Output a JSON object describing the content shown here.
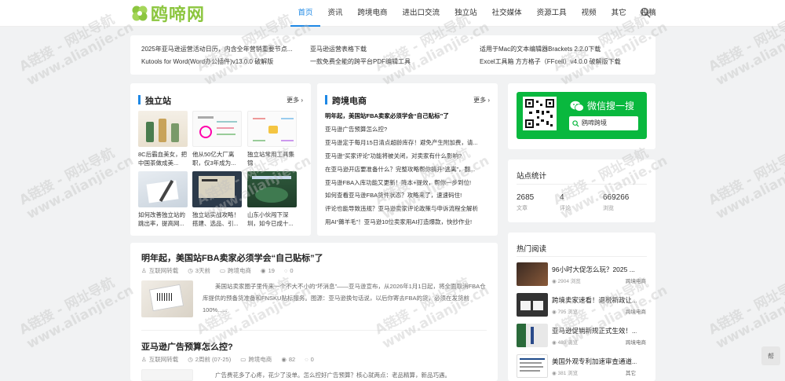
{
  "brand": {
    "logo_text": "鸥啼网"
  },
  "nav": {
    "items": [
      "首页",
      "资讯",
      "跨境电商",
      "进出口交流",
      "独立站",
      "社交媒体",
      "资源工具",
      "视频",
      "其它",
      "投稿"
    ],
    "active_index": 0
  },
  "ticker": [
    "2025年亚马逊运营活动日历，内含全年营销重要节点...",
    "Kutools for Word(Word办公插件)v13.0.0 破解版",
    "亚马逊运营表格下载",
    "一款免费全能的跨平台PDF编辑工具",
    "适用于Mac的文本编辑器Brackets 2.2.0下载",
    "Excel工具箱 方方格子（FFcell）v4.0.0 破解版下载"
  ],
  "independent": {
    "title": "独立站",
    "more": "更多",
    "items": [
      {
        "caption": "8C后霸血美女，把中国茶做成美..."
      },
      {
        "caption": "他从50亿大厂离职，仅3年成为..."
      },
      {
        "caption": "独立站常用工具集锦"
      },
      {
        "caption": "如何改善独立站的跳出率，提高网..."
      },
      {
        "caption": "独立站实战攻略！搭建、选品、引..."
      },
      {
        "caption": "山东小伙闯下深圳，如今已成十..."
      }
    ]
  },
  "cross_border": {
    "title": "跨境电商",
    "more": "更多",
    "items": [
      "明年起，美国站FBA卖家必须学会“自己贴标”了",
      "亚马逊广告预算怎么控?",
      "亚马逊定于每月15日清点超龄库存！避免产生附加费，请...",
      "亚马逊“买家评论”功能将被关闭，对卖家有什么影响?",
      "在亚马逊开店要准备什么？完整攻略帮你搞升“逃离”，翻...",
      "亚马逊FBA入库功能又更新！降本+提效，帮你一步到位!",
      "如何查看亚马逊FBA货件状态？攻略来了，速速码住!",
      "评论也能导致违规？亚马逊卖家评论政策与申诉流程全解析",
      "用AI“薅羊毛”！亚马逊10位卖家用AI打造爆款，快抄作业!"
    ]
  },
  "wechat": {
    "title": "微信搜一搜",
    "search_text": "鸥啼跨境"
  },
  "stats": {
    "title": "站点统计",
    "items": [
      {
        "num": "2685",
        "label": "文章"
      },
      {
        "num": "4",
        "label": "评论"
      },
      {
        "num": "669266",
        "label": "浏览"
      }
    ]
  },
  "hot": {
    "title": "热门阅读",
    "items": [
      {
        "title": "96小时大促怎么玩？2025 ...",
        "views": "2904 浏览",
        "cat": "跨境电商"
      },
      {
        "title": "跨境卖家速看！退税新政让...",
        "views": "795 浏览",
        "cat": "跨境电商"
      },
      {
        "title": "亚马逊促销新规正式生效！...",
        "views": "489 浏览",
        "cat": "跨境电商"
      },
      {
        "title": "美国外观专利加速审查通道...",
        "views": "381 浏览",
        "cat": "其它"
      }
    ]
  },
  "articles": [
    {
      "title": "明年起，美国站FBA卖家必须学会“自己贴标”了",
      "author": "互联网转载",
      "time": "3天前",
      "cat": "跨境电商",
      "views": "19",
      "comments": "0",
      "excerpt": "美国站卖家圈子里传来一个不大不小的“坏消息”——亚马逊宣布，从2026年1月1日起，将全面取消FBA仓库提供的预备货准备和FNSKU贴标服务。图源：亚马逊换句话说，以后你寄去FBA的货，必须在发货前100%......"
    },
    {
      "title": "亚马逊广告预算怎么控?",
      "author": "互联网转载",
      "time": "2周前 (07-25)",
      "cat": "跨境电商",
      "views": "82",
      "comments": "0",
      "excerpt": "广告费花多了心疼，花少了没单。怎么控好广告预算？核心就两点：老品精算，新品巧遇。"
    }
  ],
  "watermark": "A链接 - 网址导航\nwww.alianjie.cn",
  "float_label": "帮"
}
